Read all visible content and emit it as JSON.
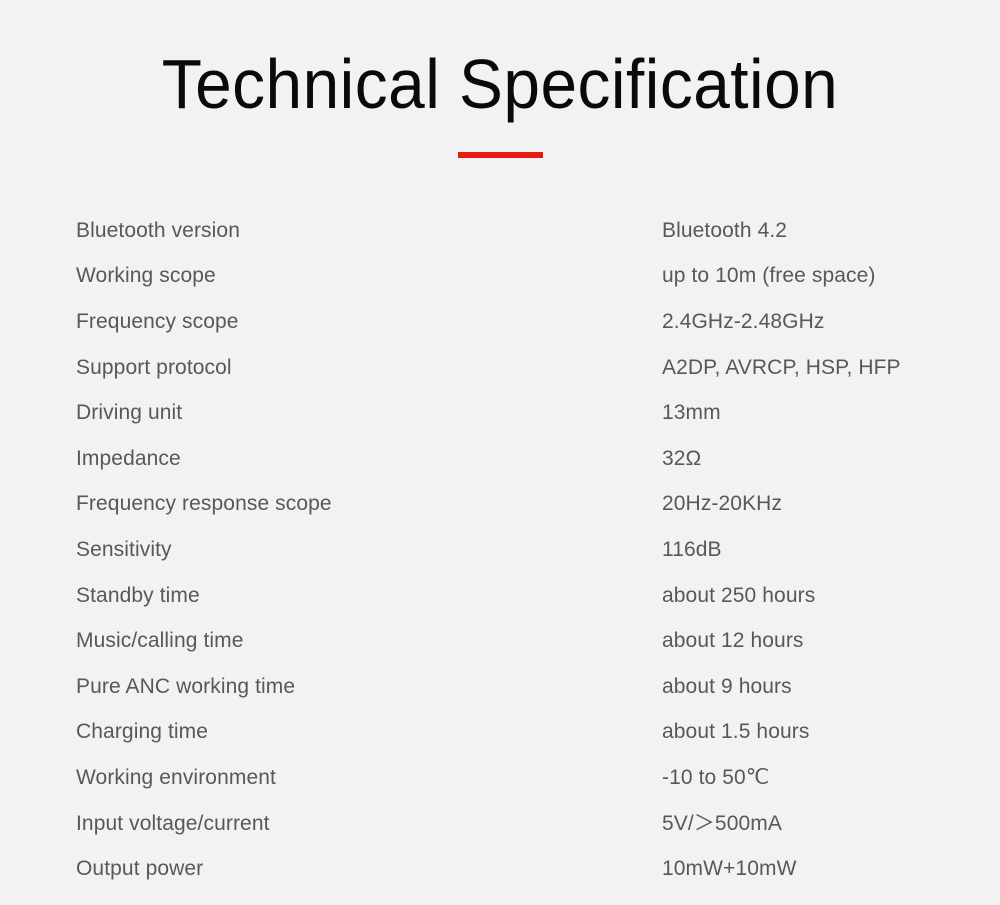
{
  "header": {
    "title": "Technical Specification",
    "accent_color": "#e81b10",
    "rule": "red-underline"
  },
  "theme": {
    "background": "#f2f2f2",
    "title_color": "#0a0a0a",
    "text_color": "#57585a"
  },
  "spec_table": {
    "rows": [
      {
        "label": "Bluetooth version",
        "value": "Bluetooth 4.2"
      },
      {
        "label": "Working scope",
        "value": "up to 10m (free space)"
      },
      {
        "label": "Frequency scope",
        "value": "2.4GHz-2.48GHz"
      },
      {
        "label": "Support protocol",
        "value": "A2DP, AVRCP, HSP, HFP"
      },
      {
        "label": "Driving unit",
        "value": "13mm"
      },
      {
        "label": "Impedance",
        "value": "32Ω"
      },
      {
        "label": "Frequency response scope",
        "value": "20Hz-20KHz"
      },
      {
        "label": "Sensitivity",
        "value": "116dB"
      },
      {
        "label": "Standby time",
        "value": "about 250 hours"
      },
      {
        "label": "Music/calling time",
        "value": "about 12 hours"
      },
      {
        "label": "Pure ANC working time",
        "value": "about 9 hours"
      },
      {
        "label": "Charging time",
        "value": "about 1.5 hours"
      },
      {
        "label": "Working environment",
        "value": "-10 to 50℃"
      },
      {
        "label": "Input voltage/current",
        "value": "5V/＞500mA"
      },
      {
        "label": "Output power",
        "value": "10mW+10mW"
      }
    ]
  }
}
